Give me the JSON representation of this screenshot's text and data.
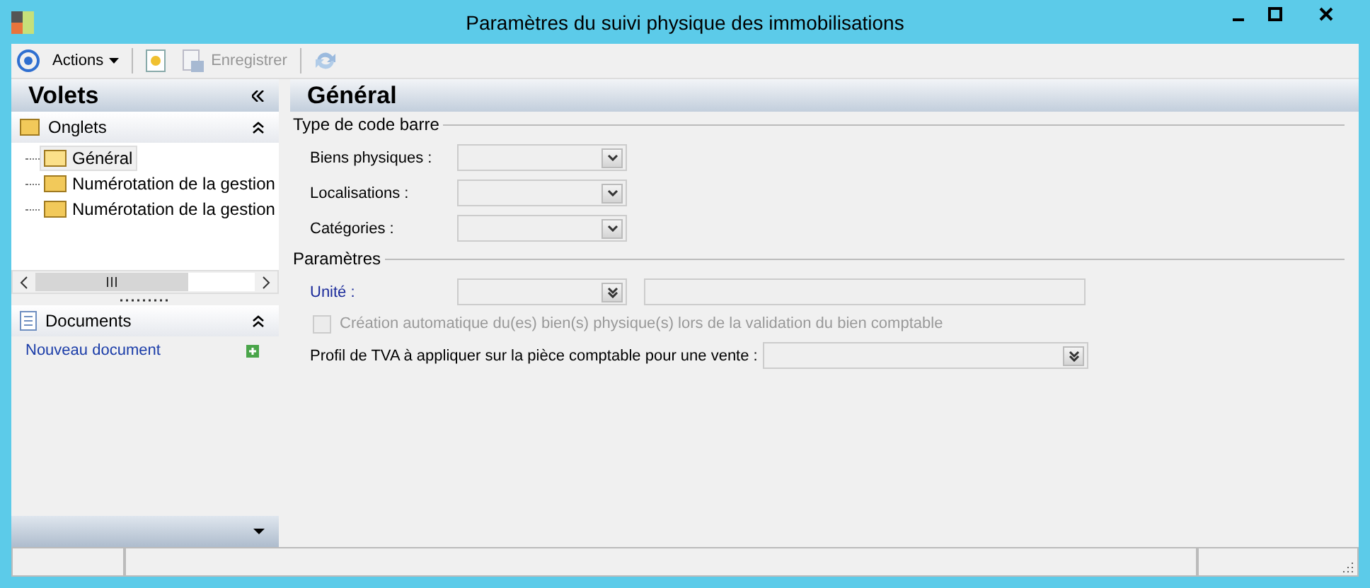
{
  "window": {
    "title": "Paramètres du suivi physique des immobilisations"
  },
  "toolbar": {
    "actions_menu": "Actions",
    "buttons": [
      {
        "kind": "new",
        "disabled": false
      },
      {
        "kind": "save",
        "label": "Enregistrer",
        "disabled": true
      },
      {
        "kind": "refresh",
        "disabled": true
      }
    ]
  },
  "sidebar": {
    "title": "Volets",
    "onglets": {
      "title": "Onglets",
      "expanded": true,
      "items": [
        {
          "label": "Général",
          "selected": true
        },
        {
          "label": "Numérotation de la gestion",
          "selected": false
        },
        {
          "label": "Numérotation de la gestion",
          "selected": false
        }
      ]
    },
    "documents": {
      "title": "Documents",
      "expanded": true,
      "link": "Nouveau document"
    }
  },
  "main": {
    "title": "Général",
    "barcode_group": {
      "title": "Type de code barre",
      "fields": [
        {
          "label": "Biens physiques :"
        },
        {
          "label": "Localisations :"
        },
        {
          "label": "Catégories :"
        }
      ]
    },
    "params_group": {
      "title": "Paramètres",
      "rows": [
        {
          "kind": "pair",
          "label": "Unité :"
        },
        {
          "kind": "checkbox",
          "label": "Création automatique du(es) bien(s) physique(s) lors de la validation du bien comptable",
          "checked": false,
          "disabled": true
        },
        {
          "kind": "wide",
          "label": "Profil de TVA à appliquer sur la pièce comptable pour une vente :"
        }
      ]
    }
  }
}
